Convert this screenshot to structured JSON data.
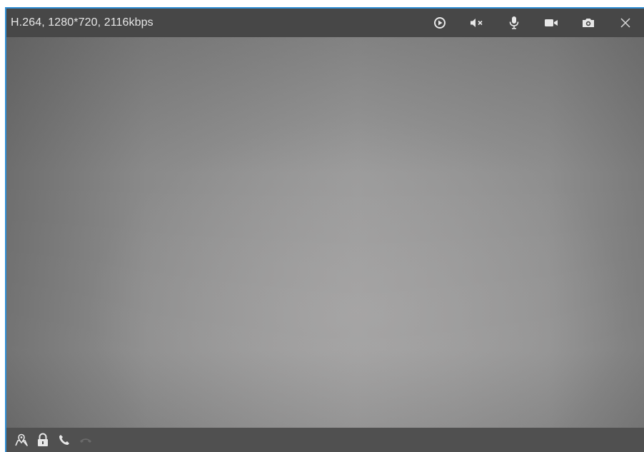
{
  "stream_info": "H.264, 1280*720, 2116kbps",
  "top_controls": [
    {
      "icon": "play-circle-icon"
    },
    {
      "icon": "speaker-muted-icon"
    },
    {
      "icon": "microphone-icon"
    },
    {
      "icon": "video-camera-icon"
    },
    {
      "icon": "camera-snapshot-icon"
    },
    {
      "icon": "close-icon"
    }
  ],
  "bottom_controls": [
    {
      "icon": "map-location-icon"
    },
    {
      "icon": "lock-icon"
    },
    {
      "icon": "phone-icon"
    },
    {
      "icon": "hang-up-icon"
    }
  ],
  "colors": {
    "accent_border": "#2f8fd6",
    "bar_background": "#474747",
    "icon": "#e8e8e8",
    "icon_disabled": "#6a6a6a"
  }
}
